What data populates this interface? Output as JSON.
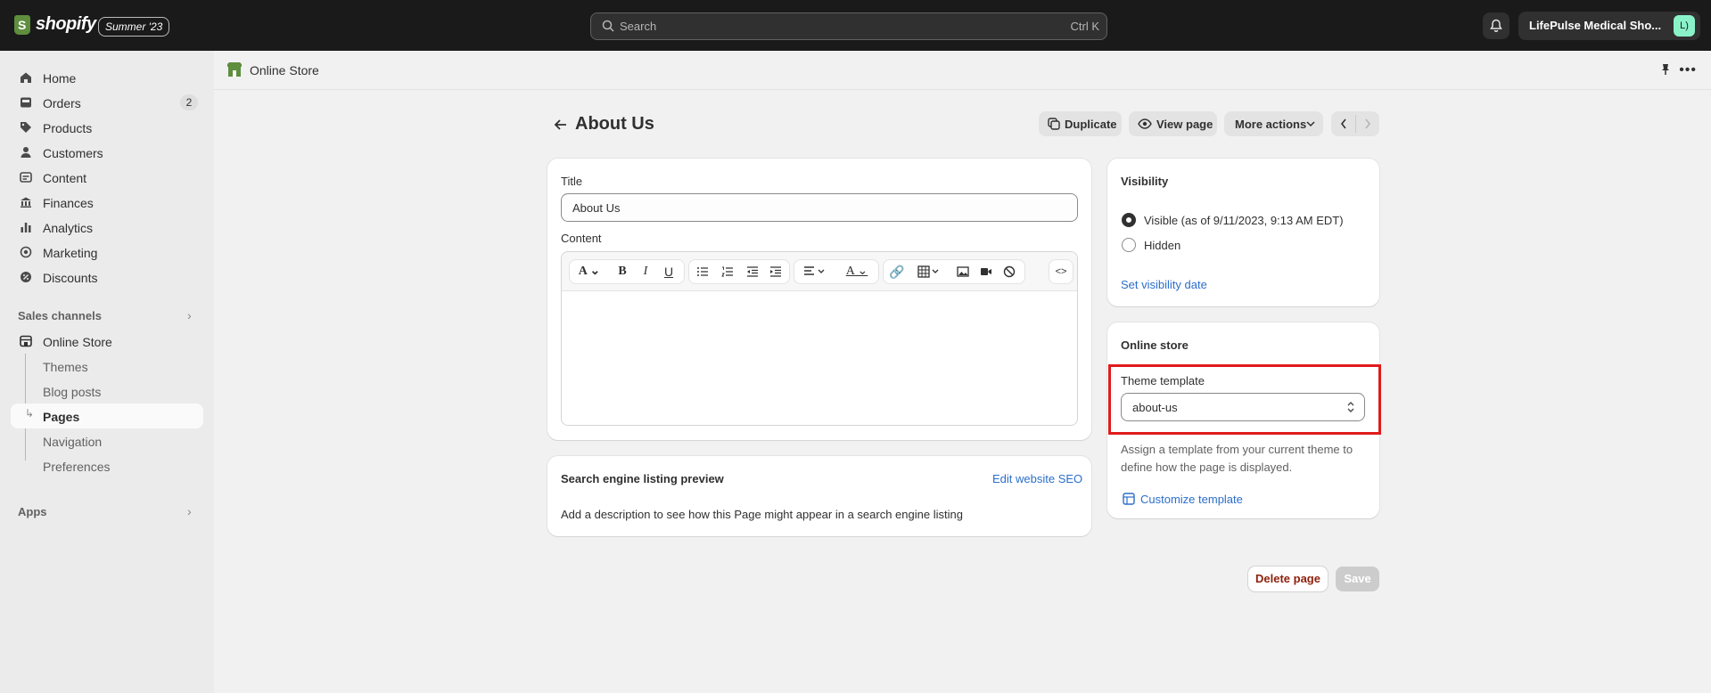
{
  "topbar": {
    "brand": "shopify",
    "edition": "Summer '23",
    "search_placeholder": "Search",
    "search_shortcut": "Ctrl K",
    "store_name": "LifePulse Medical Sho...",
    "avatar_initials": "L)"
  },
  "sidebar": {
    "items": [
      {
        "label": "Home",
        "icon": "home-icon"
      },
      {
        "label": "Orders",
        "icon": "orders-icon",
        "count": "2"
      },
      {
        "label": "Products",
        "icon": "tag-icon"
      },
      {
        "label": "Customers",
        "icon": "person-icon"
      },
      {
        "label": "Content",
        "icon": "content-icon"
      },
      {
        "label": "Finances",
        "icon": "bank-icon"
      },
      {
        "label": "Analytics",
        "icon": "bar-chart-icon"
      },
      {
        "label": "Marketing",
        "icon": "target-icon"
      },
      {
        "label": "Discounts",
        "icon": "discount-icon"
      }
    ],
    "sales_channels_label": "Sales channels",
    "online_store_label": "Online Store",
    "sub_items": [
      "Themes",
      "Blog posts",
      "Pages",
      "Navigation",
      "Preferences"
    ],
    "apps_label": "Apps"
  },
  "breadcrumb": {
    "label": "Online Store"
  },
  "page": {
    "title": "About Us",
    "actions": {
      "duplicate": "Duplicate",
      "view_page": "View page",
      "more_actions": "More actions"
    }
  },
  "main_card": {
    "title_label": "Title",
    "title_value": "About Us",
    "content_label": "Content"
  },
  "seo_card": {
    "heading": "Search engine listing preview",
    "edit_link": "Edit website SEO",
    "description": "Add a description to see how this Page might appear in a search engine listing"
  },
  "visibility_card": {
    "heading": "Visibility",
    "visible_label": "Visible (as of 9/11/2023, 9:13 AM EDT)",
    "hidden_label": "Hidden",
    "set_date_link": "Set visibility date",
    "selected": "visible"
  },
  "online_store_card": {
    "heading": "Online store",
    "template_label": "Theme template",
    "template_value": "about-us",
    "help_text": "Assign a template from your current theme to define how the page is displayed.",
    "customize_link": "Customize template"
  },
  "footer": {
    "delete_label": "Delete page",
    "save_label": "Save"
  },
  "colors": {
    "topbar": "#1a1a1a",
    "link": "#2c6ecb",
    "highlight": "#e01b1b",
    "danger_text": "#8e1f0b"
  }
}
